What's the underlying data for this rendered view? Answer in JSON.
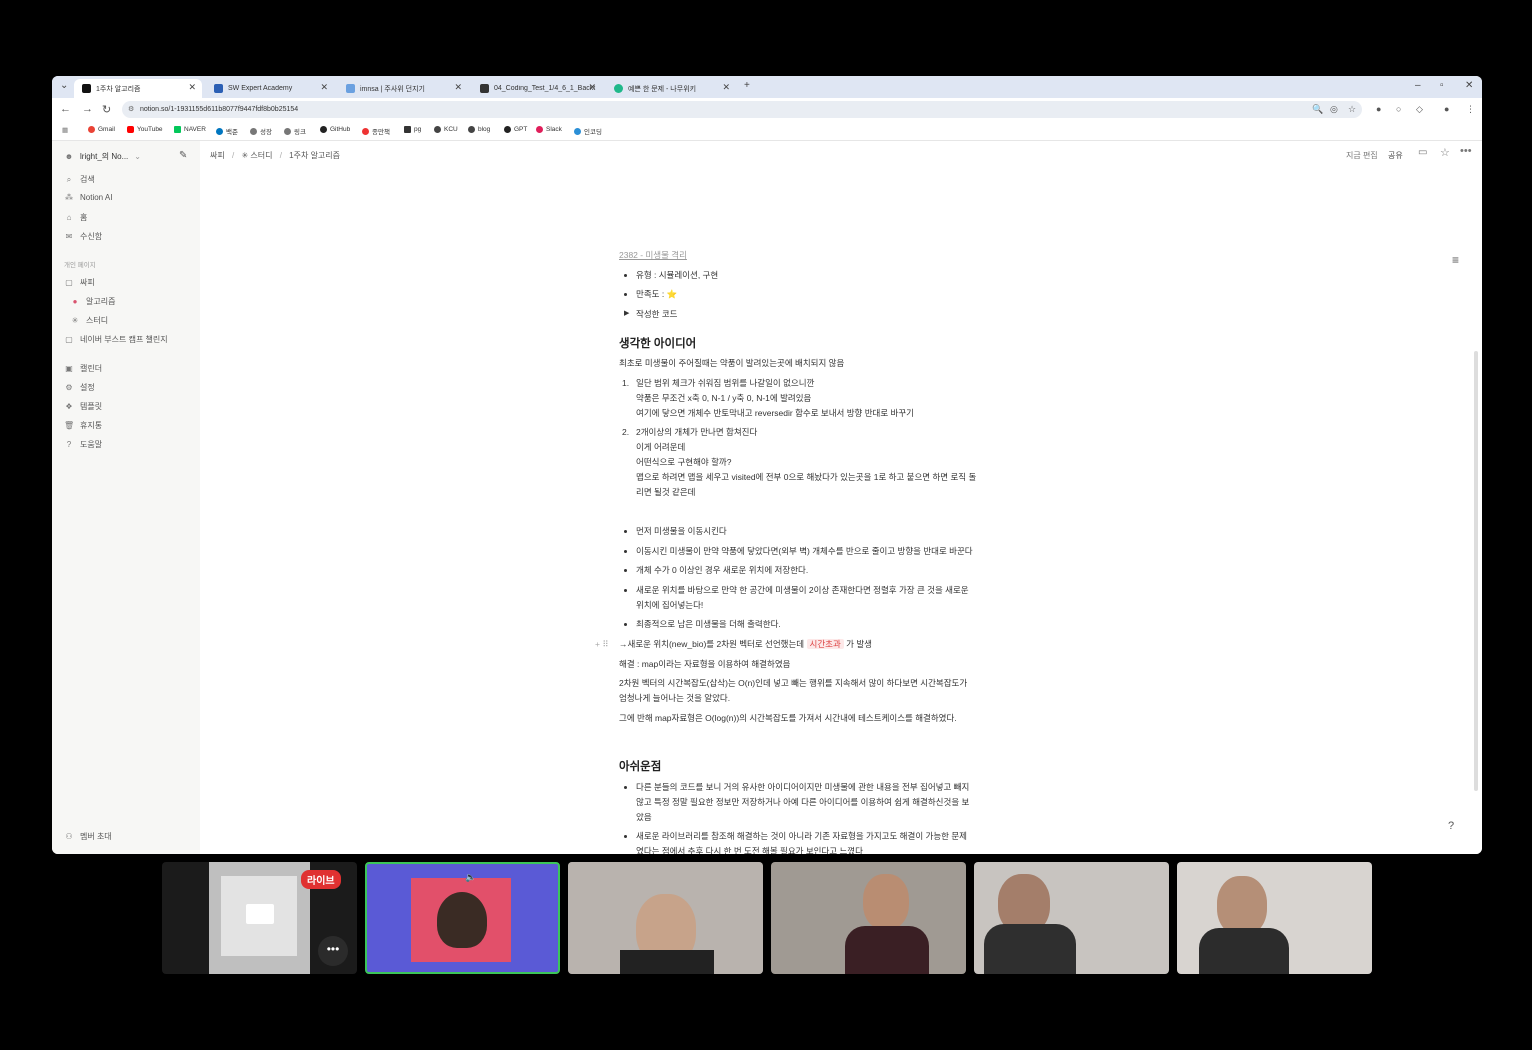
{
  "browser": {
    "tabs": [
      {
        "label": "1주차 알고리즘",
        "color": "#111"
      },
      {
        "label": "SW Expert Academy",
        "color": "#2b5fb4"
      },
      {
        "label": "imnsa | 주사위 던지기",
        "color": "#6aa0e0"
      },
      {
        "label": "04_Coding_Test_1/4_6_1_Backt",
        "color": "#333"
      },
      {
        "label": "예쁜 한 문제 - 나무위키",
        "color": "#1fb88a"
      }
    ],
    "url": "notion.so/1-1931155d611b8077f9447fdf8b0b25154",
    "bookmarks": [
      "Gmail",
      "YouTube",
      "NAVER",
      "백준",
      "성장",
      "링크",
      "GitHub",
      "종만책",
      "pg",
      "KCU",
      "blog",
      "GPT",
      "Slack",
      "인코딩"
    ]
  },
  "sidebar": {
    "workspace": "lright_의 No...",
    "top_items": [
      {
        "label": "검색",
        "icon": "search-icon"
      },
      {
        "label": "Notion AI",
        "icon": "ai-icon"
      },
      {
        "label": "홈",
        "icon": "home-icon"
      },
      {
        "label": "수신함",
        "icon": "inbox-icon"
      }
    ],
    "section_label": "개인 페이지",
    "pages": [
      {
        "label": "싸피",
        "icon": "page-icon"
      },
      {
        "label": "알고리즘",
        "icon": "circle-icon"
      },
      {
        "label": "스터디",
        "icon": "star-icon"
      },
      {
        "label": "네이버 부스트 캠프 챌린지",
        "icon": "page-icon"
      }
    ],
    "bottom_items": [
      {
        "label": "캘린더",
        "icon": "calendar-icon"
      },
      {
        "label": "설정",
        "icon": "gear-icon"
      },
      {
        "label": "템플릿",
        "icon": "template-icon"
      },
      {
        "label": "휴지통",
        "icon": "trash-icon"
      },
      {
        "label": "도움말",
        "icon": "help-icon"
      }
    ],
    "invite": "멤버 초대"
  },
  "header": {
    "breadcrumb": [
      "싸피",
      "스터디",
      "1주차 알고리즘"
    ],
    "edited": "지금 편집",
    "share": "공유"
  },
  "doc": {
    "problem": "2382 - 미생물 격리",
    "type_line": "유형 : 시뮬레이션, 구현",
    "satisfaction": "만족도 : ⭐",
    "toggle": "작성한 코드",
    "heading1": "생각한 아이디어",
    "p1": "최초로 미생물이 주어질때는 약품이 발려있는곳에 배치되지 않음",
    "ol1": [
      "일단 범위 체크가 쉬워짐 범위를 나갈일이 없으니깐",
      "약품은 무조건 x축 0, N-1 / y축 0, N-1에 발려있음",
      "여기에 닿으면 개체수 반토막내고 reversedir 함수로 보내서 방향 반대로 바꾸기"
    ],
    "ol2": [
      "2개이상의 개체가 만나면 합쳐진다",
      "이게 어려운데",
      "어떤식으로 구현해야 할까?",
      "맵으로 하려면 맵을 세우고 visited에 전부 0으로 해놨다가 있는곳을 1로 하고 붙으면 하면 로직 돌",
      "리면 될것 같은데"
    ],
    "bullets": [
      "먼저 미생물을 이동시킨다",
      "이동시킨 미생물이 만약 약품에 닿았다면(외부 벽) 개체수를 반으로 줄이고 방향을 반대로 바꾼다",
      "개체 수가 0 이상인 경우 새로운 위치에 저장한다.",
      "새로운 위치를 바탕으로 만약 한 공간에 미생물이 2이상 존재한다면 정렬후 가장 큰 것을 새로운",
      "위치에 집어넣는다!",
      "최종적으로 남은 미생물을 더해 출력한다."
    ],
    "arrow_line": "→새로운 위치(new_bio)를 2차원 벡터로 선언했는데",
    "tag": "시간초과",
    "arrow_tail": "가 발생",
    "solution": "해결 : map이라는 자료형을 이용하여 해결하였음",
    "p2a": "2차원 벡터의 시간복잡도(삽삭)는 O(n)인데 넣고 빼는 행위를 지속해서 많이 하다보면 시간복잡도가",
    "p2b": "엄청나게 늘어나는 것을 알았다.",
    "p3": "그에 반해  map자료형은 O(log(n))의 시간복잡도를 가져서 시간내에 테스트케이스를 해결하였다.",
    "heading2": "아쉬운점",
    "b2": [
      "다른 분들의 코드를 보니 거의 유사한 아이디어이지만 미생물에 관한 내용을 전부 집어넣고 빼지",
      "않고 특정 정말 필요한 정보만 저장하거나 아예 다른 아이디어를 이용하여 쉽게 해결하신것을 보",
      "았음",
      "새로운 라이브러리를 참조해 해결하는 것이 아니라 기존 자료형을 가지고도 해결이 가능한 문제",
      "였다는 점에서 추후 다시 한 번 도전 해볼 필요가 보인다고 느꼈다"
    ]
  },
  "meeting": {
    "live_badge": "라이브"
  }
}
